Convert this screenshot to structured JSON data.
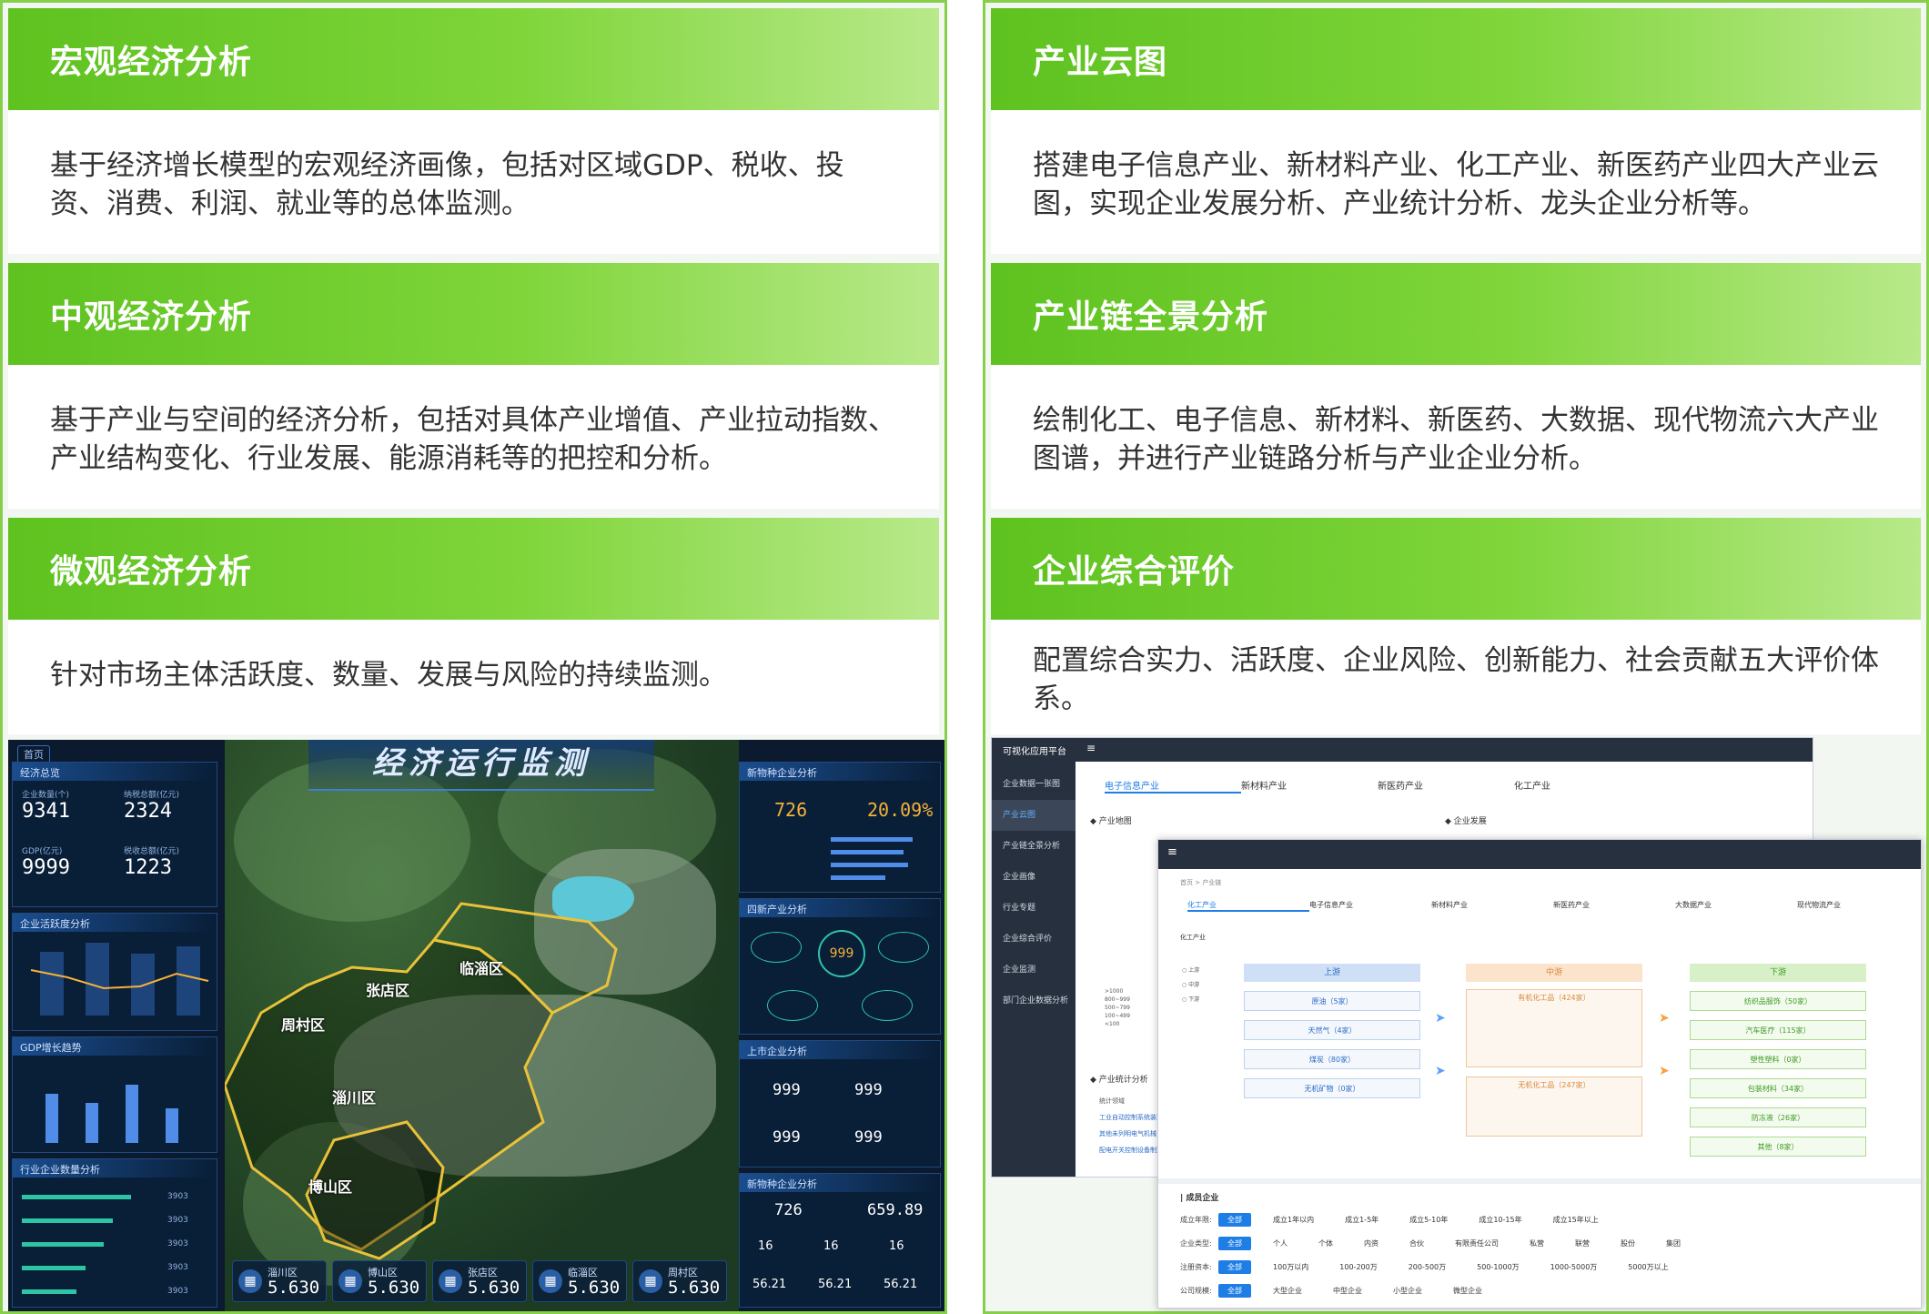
{
  "left": {
    "sections": [
      {
        "title": "宏观经济分析",
        "body": "基于经济增长模型的宏观经济画像，包括对区域GDP、税收、投资、消费、利润、就业等的总体监测。"
      },
      {
        "title": "中观经济分析",
        "body": "基于产业与空间的经济分析，包括对具体产业增值、产业拉动指数、产业结构变化、行业发展、能源消耗等的把控和分析。"
      },
      {
        "title": "微观经济分析",
        "body": "针对市场主体活跃度、数量、发展与风险的持续监测。"
      }
    ],
    "dashboard": {
      "title": "经济运行监测",
      "tag": "首页",
      "overview_title": "经济总览",
      "overview": [
        {
          "label": "企业数量(个)",
          "value": "9341"
        },
        {
          "label": "纳税总额(亿元)",
          "value": "2324"
        },
        {
          "label": "GDP(亿元)",
          "value": "9999"
        },
        {
          "label": "税收总额(亿元)",
          "value": "1223"
        }
      ],
      "activity_title": "企业活跃度分析",
      "gdp_title": "GDP增长趋势",
      "industry_title": "行业企业数量分析",
      "right1_title": "新物种企业分析",
      "right1_values": [
        "726",
        "20.09%"
      ],
      "right2_title": "四新产业分析",
      "right2_center": "999",
      "right3_title": "上市企业分析",
      "right3_values": [
        "999",
        "999",
        "999",
        "999"
      ],
      "right4_title": "新物种企业分析",
      "right4_values": [
        "726",
        "659.89",
        "16",
        "16",
        "16",
        "56.21",
        "56.21",
        "56.21"
      ],
      "regions": [
        "周村区",
        "张店区",
        "临淄区",
        "淄川区",
        "博山区"
      ],
      "bottom": [
        {
          "name": "淄川区",
          "value": "5.630"
        },
        {
          "name": "博山区",
          "value": "5.630"
        },
        {
          "name": "张店区",
          "value": "5.630"
        },
        {
          "name": "临淄区",
          "value": "5.630"
        },
        {
          "name": "周村区",
          "value": "5.630"
        }
      ],
      "industry_values": [
        "3903",
        "3903",
        "3903",
        "3903",
        "3903"
      ]
    }
  },
  "right": {
    "sections": [
      {
        "title": "产业云图",
        "body": "搭建电子信息产业、新材料产业、化工产业、新医药产业四大产业云图，实现企业发展分析、产业统计分析、龙头企业分析等。"
      },
      {
        "title": "产业链全景分析",
        "body": "绘制化工、电子信息、新材料、新医药、大数据、现代物流六大产业图谱，并进行产业链路分析与产业企业分析。"
      },
      {
        "title": "企业综合评价",
        "body": "配置综合实力、活跃度、企业风险、创新能力、社会贡献五大评价体系。"
      }
    ],
    "app1": {
      "brand": "可视化应用平台",
      "menu": [
        "企业数据一张图",
        "产业云图",
        "产业链全景分析",
        "企业画像",
        "行业专题",
        "企业综合评价",
        "企业监测",
        "部门企业数据分析"
      ],
      "tabs": [
        "电子信息产业",
        "新材料产业",
        "新医药产业",
        "化工产业"
      ],
      "map_title": "产业地图",
      "dev_title": "企业发展",
      "stat_title": "产业统计分析",
      "stat_rows": [
        "统计领域",
        "工业自动控制系统装置",
        "其他未列明电气机械",
        "配电开关控制设备制造"
      ],
      "legend": [
        ">1000",
        "800~999",
        "500~799",
        "100~499",
        "<100"
      ]
    },
    "app2": {
      "breadcrumb": "首页 > 产业链",
      "tabs": [
        "化工产业",
        "电子信息产业",
        "新材料产业",
        "新医药产业",
        "大数据产业",
        "现代物流产业"
      ],
      "sub": "化工产业",
      "legend": [
        "上游",
        "中游",
        "下游"
      ],
      "upstream_head": "上游",
      "midstream_head": "中游",
      "downstream_head": "下游",
      "upstream": [
        "原油（5家）",
        "天然气（4家）",
        "煤炭（80家）",
        "无机矿物（0家）"
      ],
      "midstream_groups": [
        "有机化工品（424家）",
        "无机化工品（247家）"
      ],
      "downstream": [
        "纺织品服饰（50家）",
        "汽车医疗（115家）",
        "塑性塑料（0家）",
        "包装材料（34家）",
        "防冻液（26家）",
        "其他（8家）"
      ],
      "members_title": "成员企业",
      "filters": [
        {
          "label": "成立年限:",
          "options": [
            "全部",
            "成立1年以内",
            "成立1-5年",
            "成立5-10年",
            "成立10-15年",
            "成立15年以上"
          ]
        },
        {
          "label": "企业类型:",
          "options": [
            "全部",
            "个人",
            "个体",
            "内资",
            "合伙",
            "有限责任公司",
            "私营",
            "联营",
            "股份",
            "集团"
          ]
        },
        {
          "label": "注册资本:",
          "options": [
            "全部",
            "100万以内",
            "100-200万",
            "200-500万",
            "500-1000万",
            "1000-5000万",
            "5000万以上"
          ]
        },
        {
          "label": "公司规模:",
          "options": [
            "全部",
            "大型企业",
            "中型企业",
            "小型企业",
            "微型企业"
          ]
        }
      ]
    }
  }
}
